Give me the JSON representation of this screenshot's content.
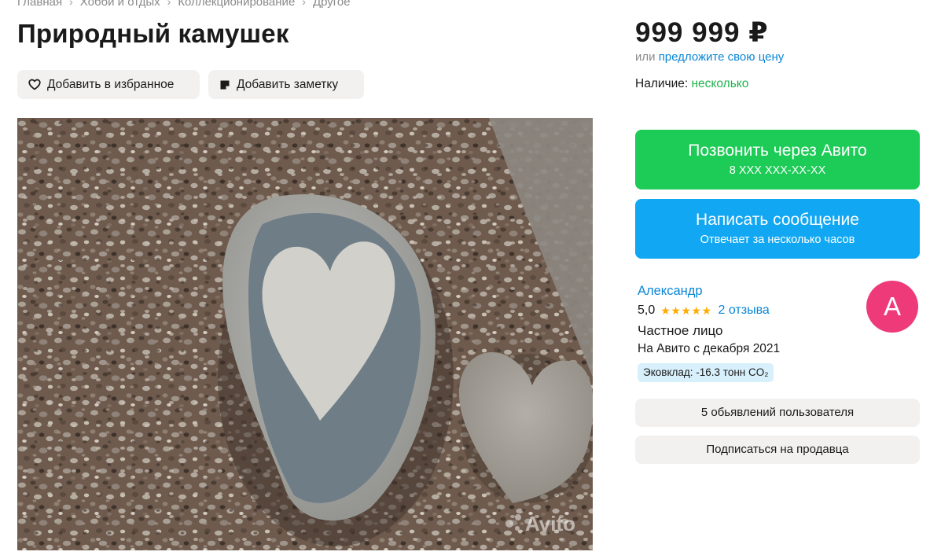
{
  "breadcrumb": [
    "Главная",
    "Хобби и отдых",
    "Коллекционирование",
    "Другое"
  ],
  "title": "Природный камушек",
  "actions": {
    "favorite_label": "Добавить в избранное",
    "note_label": "Добавить заметку"
  },
  "photo": {
    "watermark": "Avito"
  },
  "price": {
    "value": "999 999 ₽",
    "offer_prefix": "или",
    "offer_link": "предложите свою цену"
  },
  "stock": {
    "label": "Наличие:",
    "value": "несколько"
  },
  "call_button": {
    "label": "Позвонить через Авито",
    "phone": "8 XXX XXX-XX-XX"
  },
  "message_button": {
    "label": "Написать сообщение",
    "sub": "Отвечает за несколько часов"
  },
  "seller": {
    "name": "Александр",
    "rating": "5,0",
    "stars": 5,
    "reviews": "2 отзыва",
    "type": "Частное лицо",
    "since": "На Авито с декабря 2021",
    "eco": "Эковклад: -16.3 тонн CO₂",
    "avatar_letter": "А"
  },
  "seller_actions": {
    "listings": "5 обьявлений пользователя",
    "subscribe": "Подписаться на продавца"
  },
  "colors": {
    "call": "#1dcb57",
    "message": "#11a7f2",
    "link": "#0a86d6",
    "stock": "#1fb24d",
    "avatar": "#ee3a79",
    "star": "#ffab00"
  }
}
